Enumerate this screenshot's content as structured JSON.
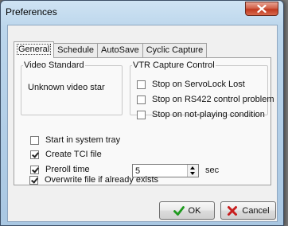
{
  "window": {
    "title": "Preferences"
  },
  "tabs": [
    {
      "label": "General",
      "active": true
    },
    {
      "label": "Schedule",
      "active": false
    },
    {
      "label": "AutoSave",
      "active": false
    },
    {
      "label": "Cyclic Capture",
      "active": false
    }
  ],
  "video_standard": {
    "legend": "Video Standard",
    "value": "Unknown video star"
  },
  "vtr": {
    "legend": "VTR Capture Control",
    "options": [
      {
        "label": "Stop on ServoLock Lost",
        "checked": false
      },
      {
        "label": "Stop on RS422 control problem",
        "checked": false
      },
      {
        "label": "Stop on not-playing condition",
        "checked": false
      }
    ]
  },
  "options": {
    "start_tray": {
      "label": "Start in system tray",
      "checked": false
    },
    "create_tci": {
      "label": "Create TCI file",
      "checked": true
    },
    "preroll": {
      "label": "Preroll time",
      "checked": true,
      "value": "5",
      "unit": "sec"
    },
    "overwrite": {
      "label": "Overwrite file if already exists",
      "checked": true
    }
  },
  "buttons": {
    "ok": "OK",
    "cancel": "Cancel"
  },
  "icons": {
    "close": "close-icon",
    "ok": "checkmark-icon",
    "cancel": "cross-icon"
  }
}
